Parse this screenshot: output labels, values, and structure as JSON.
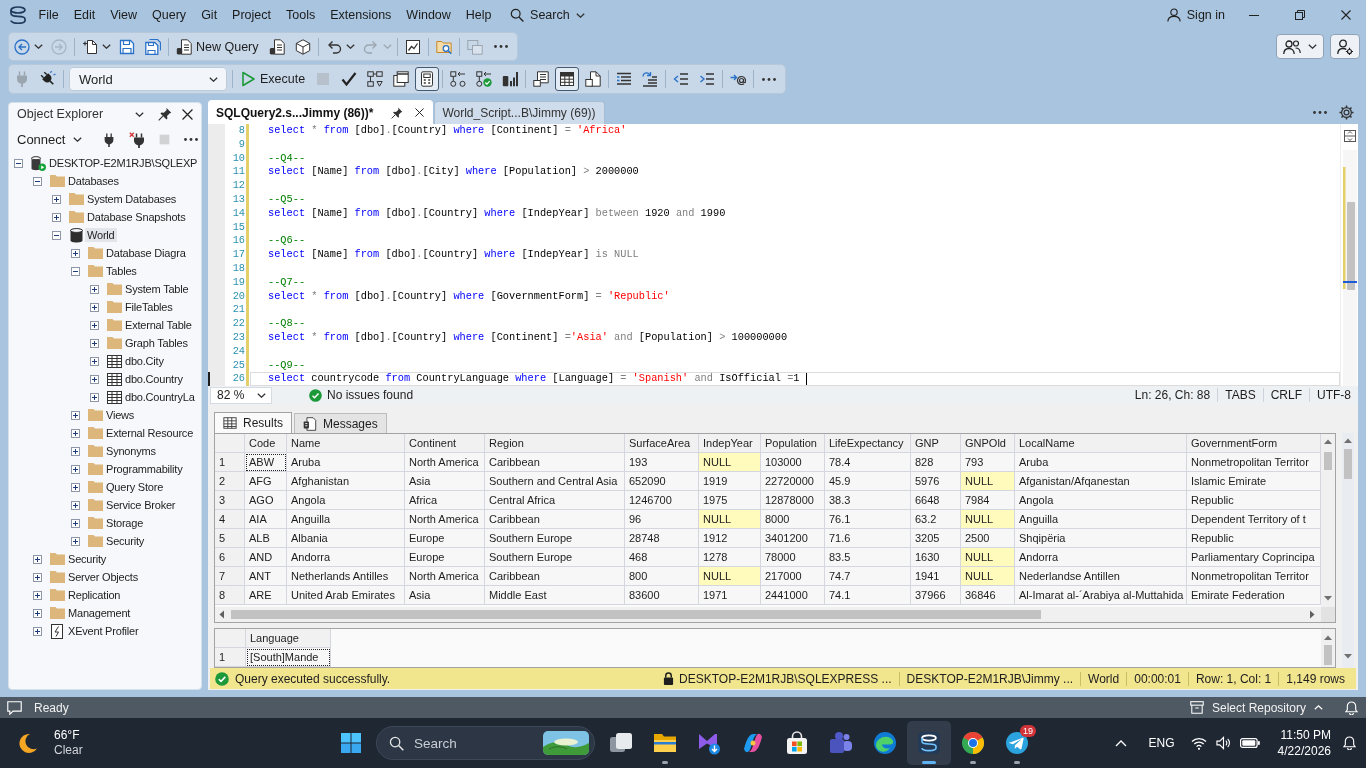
{
  "menu_bar": {
    "items": [
      "File",
      "Edit",
      "View",
      "Query",
      "Git",
      "Project",
      "Tools",
      "Extensions",
      "Window",
      "Help"
    ],
    "search": "Search",
    "sign_in": "Sign in"
  },
  "standard_toolbar": {
    "new_query": "New Query",
    "buttons": [
      {
        "disabled": false
      },
      {
        "disabled": true
      },
      {
        "disabled": false
      },
      {
        "disabled": false
      },
      {
        "disabled": false
      },
      {
        "disabled": false
      },
      {
        "disabled": false
      },
      {
        "disabled": false
      },
      {
        "disabled": false
      },
      {
        "disabled": true
      },
      {
        "disabled": false
      },
      {
        "disabled": false
      },
      {
        "disabled": true
      },
      {
        "disabled": false
      }
    ]
  },
  "query_toolbar": {
    "database": "World",
    "execute": "Execute",
    "buttons": [
      {
        "disabled": true,
        "on": false
      },
      {
        "disabled": false,
        "on": false
      },
      {
        "disabled": false,
        "on": false
      },
      {
        "disabled": true,
        "on": false
      },
      {
        "disabled": false,
        "on": false
      },
      {
        "disabled": false,
        "on": false
      },
      {
        "disabled": false,
        "on": false
      },
      {
        "disabled": false,
        "on": true
      },
      {
        "disabled": false,
        "on": false
      },
      {
        "disabled": false,
        "on": false
      },
      {
        "disabled": false,
        "on": false
      },
      {
        "disabled": false,
        "on": false
      },
      {
        "disabled": false,
        "on": true
      },
      {
        "disabled": false,
        "on": false
      },
      {
        "disabled": false,
        "on": false
      },
      {
        "disabled": false,
        "on": false
      },
      {
        "disabled": false,
        "on": false
      },
      {
        "disabled": false,
        "on": false
      },
      {
        "disabled": false,
        "on": false
      },
      {
        "disabled": false,
        "on": false
      }
    ]
  },
  "object_explorer": {
    "title": "Object Explorer",
    "connect": "Connect",
    "buttons": [
      {
        "disabled": false
      },
      {
        "disabled": false
      },
      {
        "disabled": true
      },
      {
        "disabled": false
      }
    ],
    "tree": [
      {
        "label": "DESKTOP-E2M1RJB\\SQLEXP",
        "kind": "server",
        "expanded": true,
        "selected": false,
        "children": [
          {
            "label": "Databases",
            "kind": "folder",
            "expanded": true,
            "selected": false,
            "children": [
              {
                "label": "System Databases",
                "kind": "folder",
                "expanded": false,
                "selected": false
              },
              {
                "label": "Database Snapshots",
                "kind": "folder",
                "expanded": false,
                "selected": false
              },
              {
                "label": "World",
                "kind": "database",
                "expanded": true,
                "selected": true,
                "children": [
                  {
                    "label": "Database Diagra",
                    "kind": "folder",
                    "expanded": false,
                    "selected": false
                  },
                  {
                    "label": "Tables",
                    "kind": "folder",
                    "expanded": true,
                    "selected": false,
                    "children": [
                      {
                        "label": "System Table",
                        "kind": "folder",
                        "expanded": false,
                        "selected": false
                      },
                      {
                        "label": "FileTables",
                        "kind": "folder",
                        "expanded": false,
                        "selected": false
                      },
                      {
                        "label": "External Table",
                        "kind": "folder",
                        "expanded": false,
                        "selected": false
                      },
                      {
                        "label": "Graph Tables",
                        "kind": "folder",
                        "expanded": false,
                        "selected": false
                      },
                      {
                        "label": "dbo.City",
                        "kind": "table",
                        "expanded": false,
                        "selected": false
                      },
                      {
                        "label": "dbo.Country",
                        "kind": "table",
                        "expanded": false,
                        "selected": false
                      },
                      {
                        "label": "dbo.CountryLa",
                        "kind": "table",
                        "expanded": false,
                        "selected": false
                      }
                    ]
                  },
                  {
                    "label": "Views",
                    "kind": "folder",
                    "expanded": false,
                    "selected": false
                  },
                  {
                    "label": "External Resource",
                    "kind": "folder",
                    "expanded": false,
                    "selected": false
                  },
                  {
                    "label": "Synonyms",
                    "kind": "folder",
                    "expanded": false,
                    "selected": false
                  },
                  {
                    "label": "Programmability",
                    "kind": "folder",
                    "expanded": false,
                    "selected": false
                  },
                  {
                    "label": "Query Store",
                    "kind": "folder",
                    "expanded": false,
                    "selected": false
                  },
                  {
                    "label": "Service Broker",
                    "kind": "folder",
                    "expanded": false,
                    "selected": false
                  },
                  {
                    "label": "Storage",
                    "kind": "folder",
                    "expanded": false,
                    "selected": false
                  },
                  {
                    "label": "Security",
                    "kind": "folder",
                    "expanded": false,
                    "selected": false
                  }
                ]
              }
            ]
          },
          {
            "label": "Security",
            "kind": "folder",
            "expanded": false,
            "selected": false
          },
          {
            "label": "Server Objects",
            "kind": "folder",
            "expanded": false,
            "selected": false
          },
          {
            "label": "Replication",
            "kind": "folder",
            "expanded": false,
            "selected": false
          },
          {
            "label": "Management",
            "kind": "folder",
            "expanded": false,
            "selected": false
          },
          {
            "label": "XEvent Profiler",
            "kind": "xevent",
            "expanded": false,
            "selected": false
          }
        ]
      }
    ]
  },
  "editor": {
    "tabs": [
      {
        "label": "SQLQuery2.s...Jimmy (86))*",
        "selected": true
      },
      {
        "label": "World_Script...B\\Jimmy (69))",
        "selected": false
      }
    ],
    "lines": [
      {
        "number": "8",
        "modified": true,
        "current": false,
        "tokens": [
          {
            "kind": "keyword",
            "text": "select"
          },
          {
            "kind": "operator",
            "text": " * "
          },
          {
            "kind": "keyword",
            "text": "from"
          },
          {
            "kind": "plain",
            "text": " [dbo]"
          },
          {
            "kind": "operator",
            "text": "."
          },
          {
            "kind": "plain",
            "text": "[Country] "
          },
          {
            "kind": "keyword",
            "text": "where"
          },
          {
            "kind": "plain",
            "text": " [Continent] "
          },
          {
            "kind": "operator",
            "text": "= "
          },
          {
            "kind": "string",
            "text": "'Africa'"
          }
        ]
      },
      {
        "number": "9",
        "modified": true,
        "current": false
      },
      {
        "number": "10",
        "modified": true,
        "current": false,
        "tokens": [
          {
            "kind": "comment",
            "text": "--Q4--"
          }
        ]
      },
      {
        "number": "11",
        "modified": true,
        "current": false,
        "tokens": [
          {
            "kind": "keyword",
            "text": "select"
          },
          {
            "kind": "plain",
            "text": " [Name] "
          },
          {
            "kind": "keyword",
            "text": "from"
          },
          {
            "kind": "plain",
            "text": " [dbo]"
          },
          {
            "kind": "operator",
            "text": "."
          },
          {
            "kind": "plain",
            "text": "[City] "
          },
          {
            "kind": "keyword",
            "text": "where"
          },
          {
            "kind": "plain",
            "text": " [Population] "
          },
          {
            "kind": "operator",
            "text": "> "
          },
          {
            "kind": "plain",
            "text": "2000000"
          }
        ]
      },
      {
        "number": "12",
        "modified": true,
        "current": false
      },
      {
        "number": "13",
        "modified": true,
        "current": false,
        "tokens": [
          {
            "kind": "comment",
            "text": "--Q5--"
          }
        ]
      },
      {
        "number": "14",
        "modified": true,
        "current": false,
        "tokens": [
          {
            "kind": "keyword",
            "text": "select"
          },
          {
            "kind": "plain",
            "text": " [Name] "
          },
          {
            "kind": "keyword",
            "text": "from"
          },
          {
            "kind": "plain",
            "text": " [dbo]"
          },
          {
            "kind": "operator",
            "text": "."
          },
          {
            "kind": "plain",
            "text": "[Country] "
          },
          {
            "kind": "keyword",
            "text": "where"
          },
          {
            "kind": "plain",
            "text": " [IndepYear] "
          },
          {
            "kind": "operator",
            "text": "between "
          },
          {
            "kind": "plain",
            "text": "1920 "
          },
          {
            "kind": "operator",
            "text": "and "
          },
          {
            "kind": "plain",
            "text": "1990"
          }
        ]
      },
      {
        "number": "15",
        "modified": true,
        "current": false
      },
      {
        "number": "16",
        "modified": true,
        "current": false,
        "tokens": [
          {
            "kind": "comment",
            "text": "--Q6--"
          }
        ]
      },
      {
        "number": "17",
        "modified": true,
        "current": false,
        "tokens": [
          {
            "kind": "keyword",
            "text": "select"
          },
          {
            "kind": "plain",
            "text": " [Name] "
          },
          {
            "kind": "keyword",
            "text": "from"
          },
          {
            "kind": "plain",
            "text": " [dbo]"
          },
          {
            "kind": "operator",
            "text": "."
          },
          {
            "kind": "plain",
            "text": "[Country] "
          },
          {
            "kind": "keyword",
            "text": "where"
          },
          {
            "kind": "plain",
            "text": " [IndepYear] "
          },
          {
            "kind": "operator",
            "text": "is NULL"
          }
        ]
      },
      {
        "number": "18",
        "modified": true,
        "current": false
      },
      {
        "number": "19",
        "modified": true,
        "current": false,
        "tokens": [
          {
            "kind": "comment",
            "text": "--Q7--"
          }
        ]
      },
      {
        "number": "20",
        "modified": true,
        "current": false,
        "tokens": [
          {
            "kind": "keyword",
            "text": "select"
          },
          {
            "kind": "operator",
            "text": " * "
          },
          {
            "kind": "keyword",
            "text": "from"
          },
          {
            "kind": "plain",
            "text": " [dbo]"
          },
          {
            "kind": "operator",
            "text": "."
          },
          {
            "kind": "plain",
            "text": "[Country] "
          },
          {
            "kind": "keyword",
            "text": "where"
          },
          {
            "kind": "plain",
            "text": " [GovernmentForm] "
          },
          {
            "kind": "operator",
            "text": "= "
          },
          {
            "kind": "string",
            "text": "'Republic'"
          }
        ]
      },
      {
        "number": "21",
        "modified": true,
        "current": false
      },
      {
        "number": "22",
        "modified": true,
        "current": false,
        "tokens": [
          {
            "kind": "comment",
            "text": "--Q8--"
          }
        ]
      },
      {
        "number": "23",
        "modified": true,
        "current": false,
        "tokens": [
          {
            "kind": "keyword",
            "text": "select"
          },
          {
            "kind": "operator",
            "text": " * "
          },
          {
            "kind": "keyword",
            "text": "from"
          },
          {
            "kind": "plain",
            "text": " [dbo]"
          },
          {
            "kind": "operator",
            "text": "."
          },
          {
            "kind": "plain",
            "text": "[Country] "
          },
          {
            "kind": "keyword",
            "text": "where"
          },
          {
            "kind": "plain",
            "text": " [Continent] "
          },
          {
            "kind": "operator",
            "text": "="
          },
          {
            "kind": "string",
            "text": "'Asia'"
          },
          {
            "kind": "operator",
            "text": " and "
          },
          {
            "kind": "plain",
            "text": "[Population] "
          },
          {
            "kind": "operator",
            "text": "> "
          },
          {
            "kind": "plain",
            "text": "100000000"
          }
        ]
      },
      {
        "number": "24",
        "modified": true,
        "current": false
      },
      {
        "number": "25",
        "modified": true,
        "current": false,
        "tokens": [
          {
            "kind": "comment",
            "text": "--Q9--"
          }
        ]
      },
      {
        "number": "26",
        "modified": true,
        "current": true,
        "tokens": [
          {
            "kind": "keyword",
            "text": "select"
          },
          {
            "kind": "plain",
            "text": " countrycode "
          },
          {
            "kind": "keyword",
            "text": "from"
          },
          {
            "kind": "plain",
            "text": " CountryLanguage "
          },
          {
            "kind": "keyword",
            "text": "where"
          },
          {
            "kind": "plain",
            "text": " [Language] "
          },
          {
            "kind": "operator",
            "text": "= "
          },
          {
            "kind": "string",
            "text": "'Spanish'"
          },
          {
            "kind": "operator",
            "text": " and "
          },
          {
            "kind": "plain",
            "text": "IsOfficial "
          },
          {
            "kind": "operator",
            "text": "="
          },
          {
            "kind": "plain",
            "text": "1"
          }
        ]
      }
    ],
    "zoom": "82 %",
    "issues": "No issues found",
    "caret_position": "Ln: 26, Ch: 88",
    "indentation": "TABS",
    "line_endings": "CRLF",
    "encoding": "UTF-8"
  },
  "results": {
    "tabs": [
      {
        "label": "Results",
        "selected": true
      },
      {
        "label": "Messages",
        "selected": false
      }
    ],
    "grids": [
      {
        "columns": [
          "Code",
          "Name",
          "Continent",
          "Region",
          "SurfaceArea",
          "IndepYear",
          "Population",
          "LifeExpectancy",
          "GNP",
          "GNPOld",
          "LocalName",
          "GovernmentForm"
        ],
        "rows": [
          {
            "number": "1",
            "cells": [
              {
                "text": "ABW",
                "null": false,
                "focused": true
              },
              {
                "text": "Aruba",
                "null": false,
                "focused": false
              },
              {
                "text": "North America",
                "null": false,
                "focused": false
              },
              {
                "text": "Caribbean",
                "null": false,
                "focused": false
              },
              {
                "text": "193",
                "null": false,
                "focused": false
              },
              {
                "text": "NULL",
                "null": true,
                "focused": false
              },
              {
                "text": "103000",
                "null": false,
                "focused": false
              },
              {
                "text": "78.4",
                "null": false,
                "focused": false
              },
              {
                "text": "828",
                "null": false,
                "focused": false
              },
              {
                "text": "793",
                "null": false,
                "focused": false
              },
              {
                "text": "Aruba",
                "null": false,
                "focused": false
              },
              {
                "text": "Nonmetropolitan Territor",
                "null": false,
                "focused": false
              }
            ]
          },
          {
            "number": "2",
            "cells": [
              {
                "text": "AFG",
                "null": false,
                "focused": false
              },
              {
                "text": "Afghanistan",
                "null": false,
                "focused": false
              },
              {
                "text": "Asia",
                "null": false,
                "focused": false
              },
              {
                "text": "Southern and Central Asia",
                "null": false,
                "focused": false
              },
              {
                "text": "652090",
                "null": false,
                "focused": false
              },
              {
                "text": "1919",
                "null": false,
                "focused": false
              },
              {
                "text": "22720000",
                "null": false,
                "focused": false
              },
              {
                "text": "45.9",
                "null": false,
                "focused": false
              },
              {
                "text": "5976",
                "null": false,
                "focused": false
              },
              {
                "text": "NULL",
                "null": true,
                "focused": false
              },
              {
                "text": "Afganistan/Afqanestan",
                "null": false,
                "focused": false
              },
              {
                "text": "Islamic Emirate",
                "null": false,
                "focused": false
              }
            ]
          },
          {
            "number": "3",
            "cells": [
              {
                "text": "AGO",
                "null": false,
                "focused": false
              },
              {
                "text": "Angola",
                "null": false,
                "focused": false
              },
              {
                "text": "Africa",
                "null": false,
                "focused": false
              },
              {
                "text": "Central Africa",
                "null": false,
                "focused": false
              },
              {
                "text": "1246700",
                "null": false,
                "focused": false
              },
              {
                "text": "1975",
                "null": false,
                "focused": false
              },
              {
                "text": "12878000",
                "null": false,
                "focused": false
              },
              {
                "text": "38.3",
                "null": false,
                "focused": false
              },
              {
                "text": "6648",
                "null": false,
                "focused": false
              },
              {
                "text": "7984",
                "null": false,
                "focused": false
              },
              {
                "text": "Angola",
                "null": false,
                "focused": false
              },
              {
                "text": "Republic",
                "null": false,
                "focused": false
              }
            ]
          },
          {
            "number": "4",
            "cells": [
              {
                "text": "AIA",
                "null": false,
                "focused": false
              },
              {
                "text": "Anguilla",
                "null": false,
                "focused": false
              },
              {
                "text": "North America",
                "null": false,
                "focused": false
              },
              {
                "text": "Caribbean",
                "null": false,
                "focused": false
              },
              {
                "text": "96",
                "null": false,
                "focused": false
              },
              {
                "text": "NULL",
                "null": true,
                "focused": false
              },
              {
                "text": "8000",
                "null": false,
                "focused": false
              },
              {
                "text": "76.1",
                "null": false,
                "focused": false
              },
              {
                "text": "63.2",
                "null": false,
                "focused": false
              },
              {
                "text": "NULL",
                "null": true,
                "focused": false
              },
              {
                "text": "Anguilla",
                "null": false,
                "focused": false
              },
              {
                "text": "Dependent Territory of t",
                "null": false,
                "focused": false
              }
            ]
          },
          {
            "number": "5",
            "cells": [
              {
                "text": "ALB",
                "null": false,
                "focused": false
              },
              {
                "text": "Albania",
                "null": false,
                "focused": false
              },
              {
                "text": "Europe",
                "null": false,
                "focused": false
              },
              {
                "text": "Southern Europe",
                "null": false,
                "focused": false
              },
              {
                "text": "28748",
                "null": false,
                "focused": false
              },
              {
                "text": "1912",
                "null": false,
                "focused": false
              },
              {
                "text": "3401200",
                "null": false,
                "focused": false
              },
              {
                "text": "71.6",
                "null": false,
                "focused": false
              },
              {
                "text": "3205",
                "null": false,
                "focused": false
              },
              {
                "text": "2500",
                "null": false,
                "focused": false
              },
              {
                "text": "Shqipëria",
                "null": false,
                "focused": false
              },
              {
                "text": "Republic",
                "null": false,
                "focused": false
              }
            ]
          },
          {
            "number": "6",
            "cells": [
              {
                "text": "AND",
                "null": false,
                "focused": false
              },
              {
                "text": "Andorra",
                "null": false,
                "focused": false
              },
              {
                "text": "Europe",
                "null": false,
                "focused": false
              },
              {
                "text": "Southern Europe",
                "null": false,
                "focused": false
              },
              {
                "text": "468",
                "null": false,
                "focused": false
              },
              {
                "text": "1278",
                "null": false,
                "focused": false
              },
              {
                "text": "78000",
                "null": false,
                "focused": false
              },
              {
                "text": "83.5",
                "null": false,
                "focused": false
              },
              {
                "text": "1630",
                "null": false,
                "focused": false
              },
              {
                "text": "NULL",
                "null": true,
                "focused": false
              },
              {
                "text": "Andorra",
                "null": false,
                "focused": false
              },
              {
                "text": "Parliamentary Coprincipa",
                "null": false,
                "focused": false
              }
            ]
          },
          {
            "number": "7",
            "cells": [
              {
                "text": "ANT",
                "null": false,
                "focused": false
              },
              {
                "text": "Netherlands Antilles",
                "null": false,
                "focused": false
              },
              {
                "text": "North America",
                "null": false,
                "focused": false
              },
              {
                "text": "Caribbean",
                "null": false,
                "focused": false
              },
              {
                "text": "800",
                "null": false,
                "focused": false
              },
              {
                "text": "NULL",
                "null": true,
                "focused": false
              },
              {
                "text": "217000",
                "null": false,
                "focused": false
              },
              {
                "text": "74.7",
                "null": false,
                "focused": false
              },
              {
                "text": "1941",
                "null": false,
                "focused": false
              },
              {
                "text": "NULL",
                "null": true,
                "focused": false
              },
              {
                "text": "Nederlandse Antillen",
                "null": false,
                "focused": false
              },
              {
                "text": "Nonmetropolitan Territor",
                "null": false,
                "focused": false
              }
            ]
          },
          {
            "number": "8",
            "cells": [
              {
                "text": "ARE",
                "null": false,
                "focused": false
              },
              {
                "text": "United Arab Emirates",
                "null": false,
                "focused": false
              },
              {
                "text": "Asia",
                "null": false,
                "focused": false
              },
              {
                "text": "Middle East",
                "null": false,
                "focused": false
              },
              {
                "text": "83600",
                "null": false,
                "focused": false
              },
              {
                "text": "1971",
                "null": false,
                "focused": false
              },
              {
                "text": "2441000",
                "null": false,
                "focused": false
              },
              {
                "text": "74.1",
                "null": false,
                "focused": false
              },
              {
                "text": "37966",
                "null": false,
                "focused": false
              },
              {
                "text": "36846",
                "null": false,
                "focused": false
              },
              {
                "text": "Al-Imarat al-´Arabiya al-Muttahida",
                "null": false,
                "focused": false
              },
              {
                "text": "Emirate Federation",
                "null": false,
                "focused": false
              }
            ]
          }
        ]
      },
      {
        "columns": [
          "Language"
        ],
        "rows": [
          {
            "number": "1",
            "cells": [
              {
                "text": "[South]Mande",
                "null": false,
                "focused": true
              }
            ]
          }
        ]
      }
    ]
  },
  "query_status": {
    "message": "Query executed successfully.",
    "server": "DESKTOP-E2M1RJB\\SQLEXPRESS ...",
    "login": "DESKTOP-E2M1RJB\\Jimmy ...",
    "database": "World",
    "elapsed": "00:00:01",
    "position": "Row: 1, Col: 1",
    "row_count": "1,149 rows"
  },
  "status_bar": {
    "text": "Ready",
    "repository": "Select Repository"
  },
  "taskbar": {
    "weather": {
      "temperature": "66°F",
      "condition": "Clear"
    },
    "search": "Search",
    "apps": [
      {
        "running": false,
        "active": false
      },
      {
        "running": true,
        "active": false
      },
      {
        "running": false,
        "active": false
      },
      {
        "running": false,
        "active": false
      },
      {
        "running": false,
        "active": false
      },
      {
        "running": false,
        "active": false
      },
      {
        "running": false,
        "active": false
      },
      {
        "running": true,
        "active": true
      },
      {
        "running": true,
        "active": false
      },
      {
        "running": true,
        "active": false,
        "badge": "19"
      }
    ],
    "language": "ENG",
    "time": "11:50 PM",
    "date": "4/22/2026"
  }
}
